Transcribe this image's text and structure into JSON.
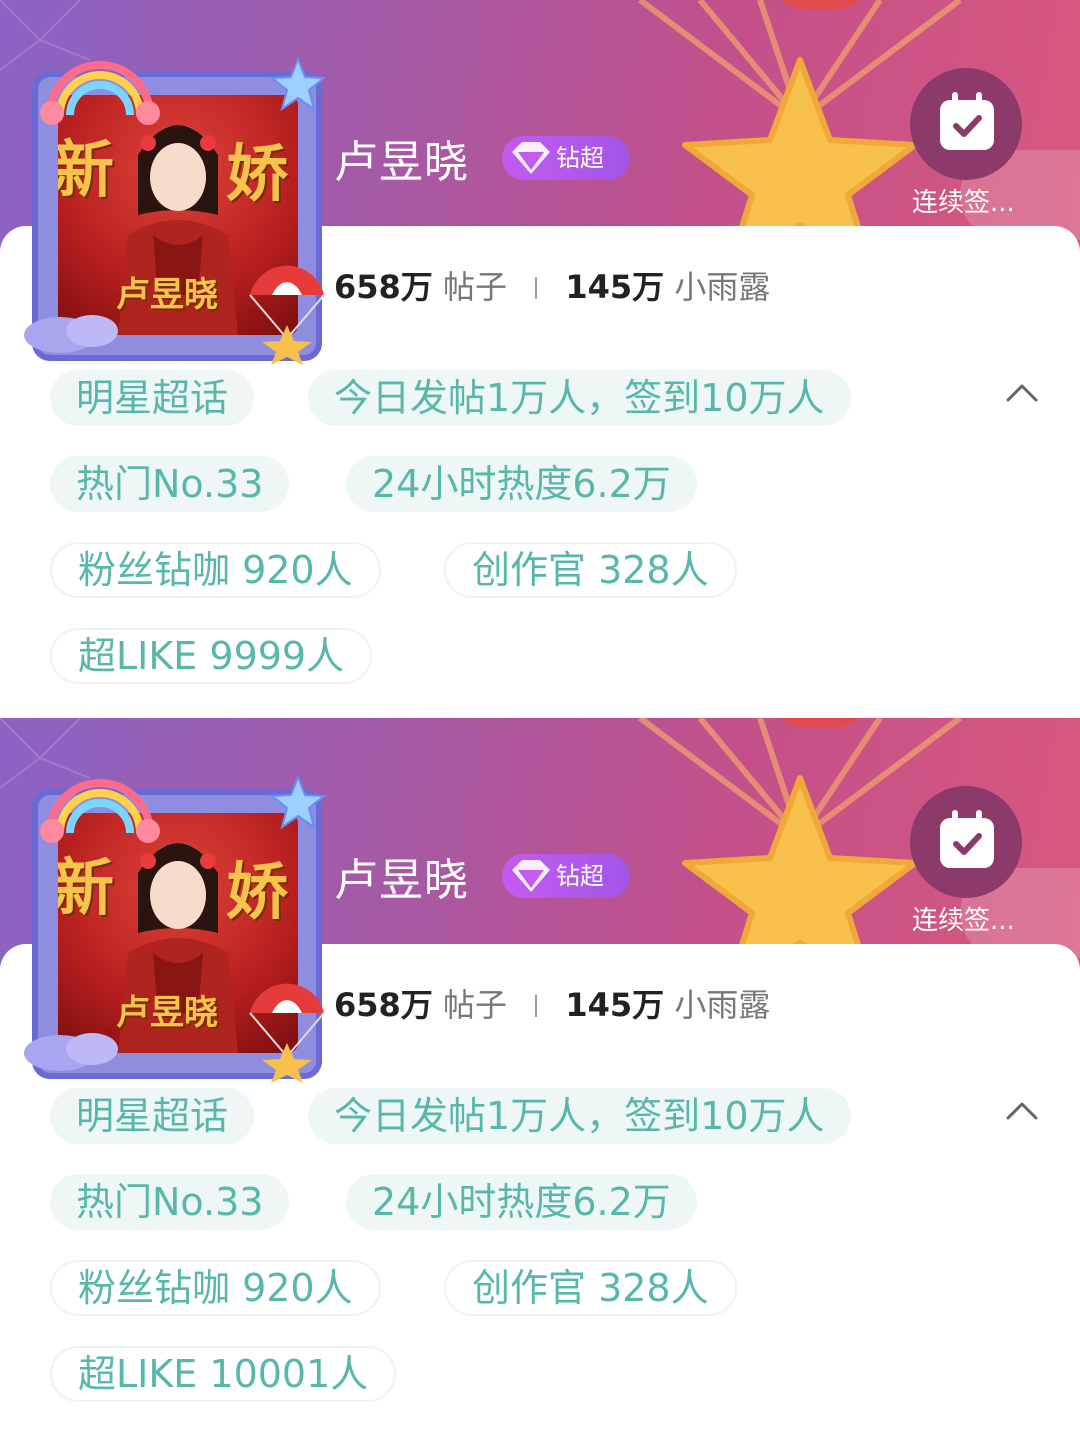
{
  "cards": [
    {
      "name": "卢昱晓",
      "badge_label": "钻超",
      "checkin_label": "连续签...",
      "posts_count": "658万",
      "posts_label": "帖子",
      "rain_count": "145万",
      "rain_label": "小雨露",
      "avatar_text_left": "新",
      "avatar_text_right": "娇",
      "avatar_name": "卢昱晓",
      "tags": {
        "category": "明星超话",
        "today": "今日发帖1万人，签到10万人",
        "hot_rank": "热门No.33",
        "heat": "24小时热度6.2万",
        "fans": "粉丝钻咖 920人",
        "creators": "创作官 328人",
        "like": "超LIKE 9999人"
      }
    },
    {
      "name": "卢昱晓",
      "badge_label": "钻超",
      "checkin_label": "连续签...",
      "posts_count": "658万",
      "posts_label": "帖子",
      "rain_count": "145万",
      "rain_label": "小雨露",
      "avatar_text_left": "新",
      "avatar_text_right": "娇",
      "avatar_name": "卢昱晓",
      "tags": {
        "category": "明星超话",
        "today": "今日发帖1万人，签到10万人",
        "hot_rank": "热门No.33",
        "heat": "24小时热度6.2万",
        "fans": "粉丝钻咖 920人",
        "creators": "创作官 328人",
        "like": "超LIKE 10001人"
      }
    }
  ],
  "icons": [
    "calendar-check-icon",
    "diamond-icon",
    "chevron-up-icon",
    "star-icon",
    "parachute-icon",
    "rainbow-icon"
  ],
  "colors": {
    "tag_text": "#58b7ab",
    "tag_bg": "#eef7f5",
    "badge": "#b158ec",
    "banner_start": "#8a63c4",
    "banner_end": "#d8597d"
  }
}
